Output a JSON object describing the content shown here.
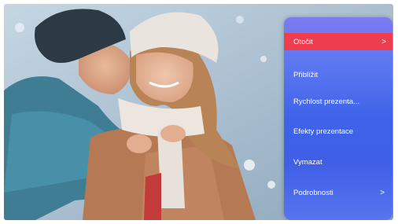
{
  "menu": {
    "items": [
      {
        "label": "Otočit",
        "arrow": ">",
        "active": true
      },
      {
        "label": "Přiblížit",
        "arrow": "",
        "active": false
      },
      {
        "label": "Rychlost prezenta...",
        "arrow": "",
        "active": false
      },
      {
        "label": "Efekty prezentace",
        "arrow": "",
        "active": false
      },
      {
        "label": "Vymazat",
        "arrow": "",
        "active": false
      },
      {
        "label": "Podrobnosti",
        "arrow": ">",
        "active": false
      }
    ]
  },
  "colors": {
    "menu_gradient_top": "#7d7bf0",
    "menu_gradient_mid": "#3e63e8",
    "highlight": "#ee3d4f"
  }
}
